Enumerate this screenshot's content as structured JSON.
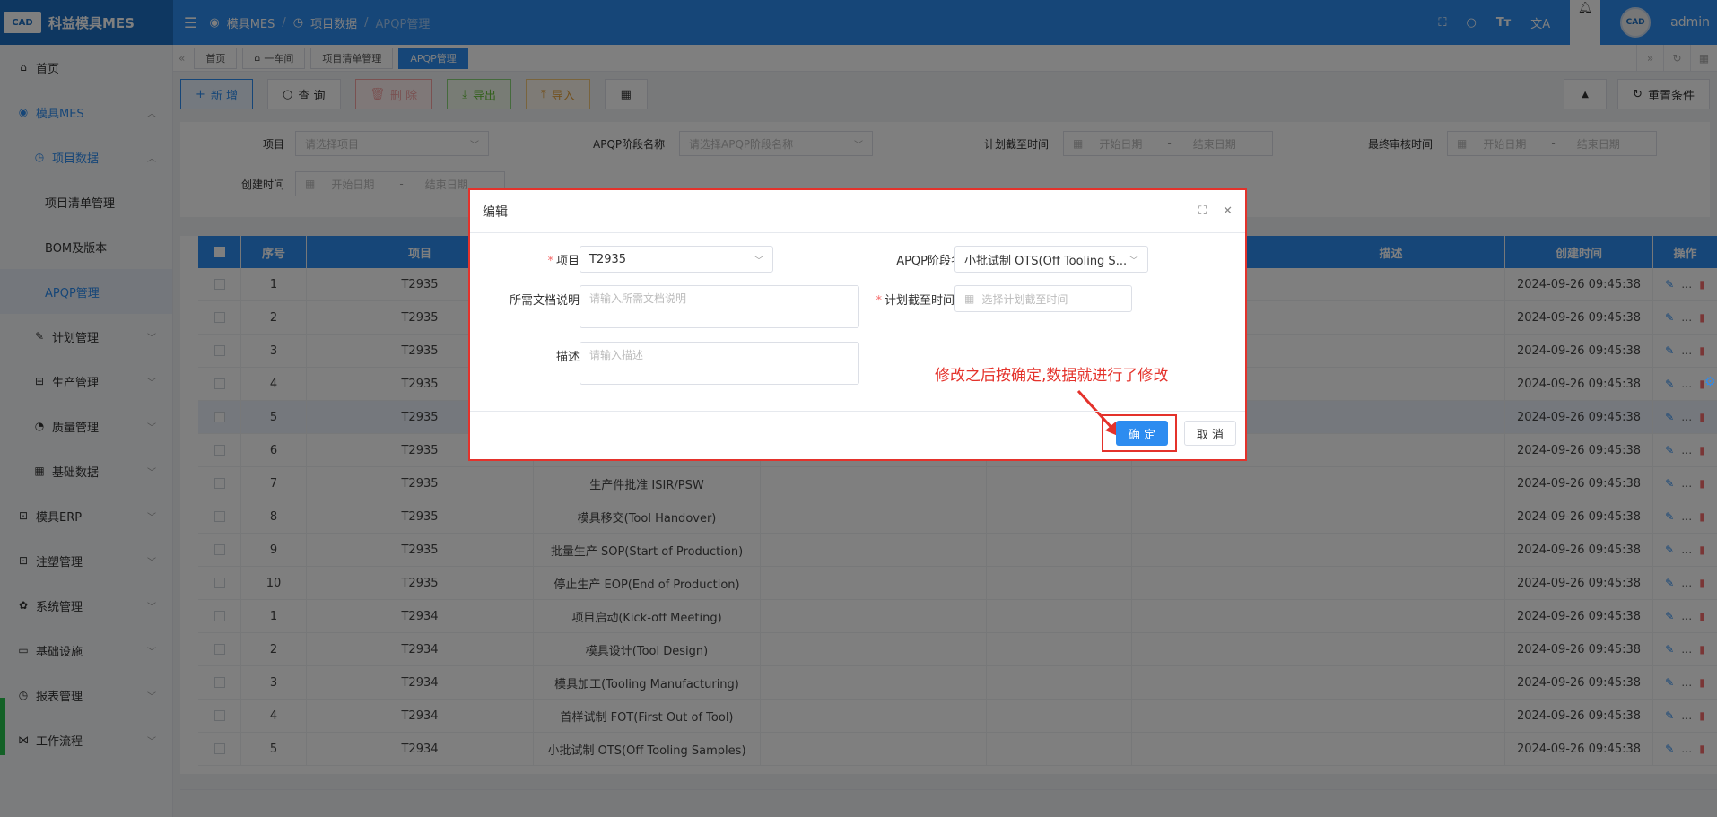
{
  "app": {
    "name": "科益模具MES",
    "logo_text": "CAD",
    "user": "admin"
  },
  "header": {
    "menu_icon": "menu-icon",
    "breadcrumb": [
      "模具MES",
      "项目数据",
      "APQP管理"
    ],
    "right_icons": [
      "fullscreen-icon",
      "search-icon",
      "font-size-icon",
      "translate-icon",
      "bell-icon"
    ]
  },
  "sidebar": {
    "items": [
      {
        "label": "首页",
        "icon": "home-icon"
      },
      {
        "label": "模具MES",
        "icon": "camera-icon",
        "expanded": true
      },
      {
        "label": "项目数据",
        "icon": "clock-icon",
        "expanded": true
      },
      {
        "label": "项目清单管理"
      },
      {
        "label": "BOM及版本"
      },
      {
        "label": "APQP管理",
        "active": true
      },
      {
        "label": "计划管理",
        "icon": "edit-icon"
      },
      {
        "label": "生产管理",
        "icon": "box-icon"
      },
      {
        "label": "质量管理",
        "icon": "timer-icon"
      },
      {
        "label": "基础数据",
        "icon": "calendar-icon"
      },
      {
        "label": "模具ERP",
        "icon": "bag-icon"
      },
      {
        "label": "注塑管理",
        "icon": "bag-icon"
      },
      {
        "label": "系统管理",
        "icon": "gear-icon"
      },
      {
        "label": "基础设施",
        "icon": "monitor-icon"
      },
      {
        "label": "报表管理",
        "icon": "chart-icon"
      },
      {
        "label": "工作流程",
        "icon": "flow-icon"
      }
    ]
  },
  "tabs": [
    "首页",
    "一车间",
    "项目清单管理",
    "APQP管理"
  ],
  "toolbar": {
    "add": "新 增",
    "query": "查 询",
    "delete": "删 除",
    "export": "导出",
    "import": "导入",
    "reset": "重置条件"
  },
  "filter": {
    "project_label": "项目",
    "project_placeholder": "请选择项目",
    "stage_label": "APQP阶段名称",
    "stage_placeholder": "请选择APQP阶段名称",
    "deadline_label": "计划截至时间",
    "final_review_label": "最终审核时间",
    "created_label": "创建时间",
    "start_date": "开始日期",
    "end_date": "结束日期",
    "dash": "-"
  },
  "table": {
    "headers": [
      "序号",
      "项目",
      "描述",
      "创建时间",
      "操作"
    ],
    "rows": [
      {
        "no": "1",
        "project": "T2935",
        "stage": "",
        "created": "2024-09-26 09:45:38"
      },
      {
        "no": "2",
        "project": "T2935",
        "stage": "",
        "created": "2024-09-26 09:45:38"
      },
      {
        "no": "3",
        "project": "T2935",
        "stage": "",
        "created": "2024-09-26 09:45:38"
      },
      {
        "no": "4",
        "project": "T2935",
        "stage": "",
        "created": "2024-09-26 09:45:38"
      },
      {
        "no": "5",
        "project": "T2935",
        "stage": "",
        "created": "2024-09-26 09:45:38"
      },
      {
        "no": "6",
        "project": "T2935",
        "stage": "",
        "created": "2024-09-26 09:45:38"
      },
      {
        "no": "7",
        "project": "T2935",
        "stage": "生产件批准 ISIR/PSW",
        "created": "2024-09-26 09:45:38"
      },
      {
        "no": "8",
        "project": "T2935",
        "stage": "模具移交(Tool Handover)",
        "created": "2024-09-26 09:45:38"
      },
      {
        "no": "9",
        "project": "T2935",
        "stage": "批量生产 SOP(Start of Production)",
        "created": "2024-09-26 09:45:38"
      },
      {
        "no": "10",
        "project": "T2935",
        "stage": "停止生产 EOP(End of Production)",
        "created": "2024-09-26 09:45:38"
      },
      {
        "no": "1",
        "project": "T2934",
        "stage": "项目启动(Kick-off Meeting)",
        "created": "2024-09-26 09:45:38"
      },
      {
        "no": "2",
        "project": "T2934",
        "stage": "模具设计(Tool Design)",
        "created": "2024-09-26 09:45:38"
      },
      {
        "no": "3",
        "project": "T2934",
        "stage": "模具加工(Tooling Manufacturing)",
        "created": "2024-09-26 09:45:38"
      },
      {
        "no": "4",
        "project": "T2934",
        "stage": "首样试制 FOT(First Out of Tool)",
        "created": "2024-09-26 09:45:38"
      },
      {
        "no": "5",
        "project": "T2934",
        "stage": "小批试制 OTS(Off Tooling Samples)",
        "created": "2024-09-26 09:45:38"
      }
    ],
    "highlight_row_index": 4
  },
  "dialog": {
    "title": "编辑",
    "project_label": "项目",
    "project_value": "T2935",
    "stage_label": "APQP阶段名称",
    "stage_value": "小批试制 OTS(Off Tooling S...",
    "doc_label": "所需文档说明",
    "doc_placeholder": "请输入所需文档说明",
    "deadline_label": "计划截至时间",
    "deadline_placeholder": "选择计划截至时间",
    "desc_label": "描述",
    "desc_placeholder": "请输入描述",
    "ok": "确 定",
    "cancel": "取 消"
  },
  "annotation": {
    "text": "修改之后按确定,数据就进行了修改",
    "color": "#e4322b"
  },
  "colors": {
    "primary": "#2d8cf0",
    "header_dark": "#1c6fc2",
    "danger": "#f56c6c",
    "annotation": "#e4322b"
  }
}
